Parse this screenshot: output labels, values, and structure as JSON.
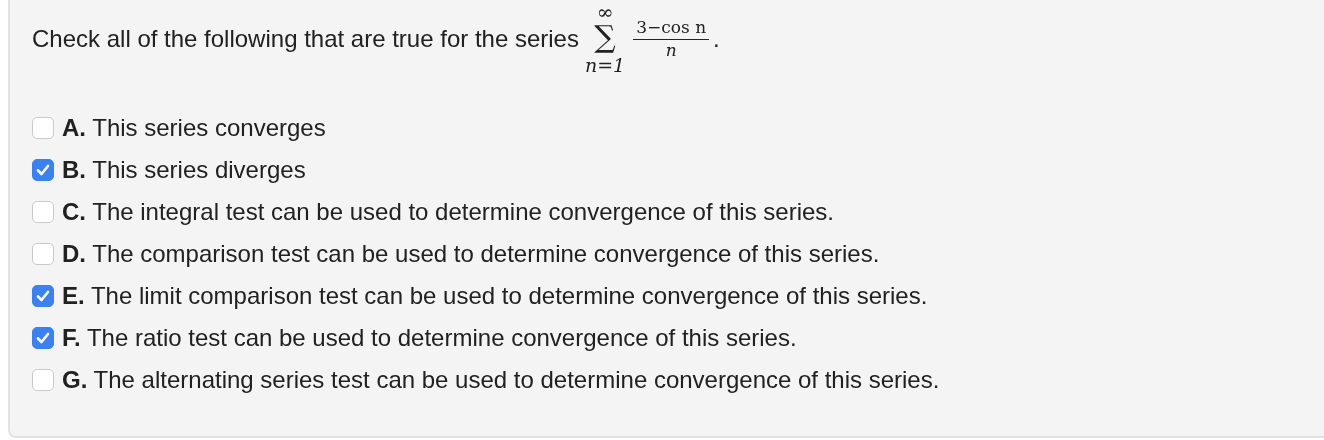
{
  "question": {
    "text": "Check all of the following that are true for the series",
    "math": {
      "upper": "∞",
      "operator": "∑",
      "lower": "n=1",
      "numerator": "3−cos n",
      "denominator": "n",
      "end": "."
    }
  },
  "options": [
    {
      "label": "**A.** This series converges",
      "checked": false
    },
    {
      "label": "**B.** This series diverges",
      "checked": true
    },
    {
      "label": "**C.** The integral test can be used to determine convergence of this series.",
      "checked": false
    },
    {
      "label": "**D.** The comparison test can be used to determine convergence of this series.",
      "checked": false
    },
    {
      "label": "**E.** The limit comparison test can be used to determine convergence of this series.",
      "checked": true
    },
    {
      "label": "**F.** The ratio test can be used to determine convergence of this series.",
      "checked": true
    },
    {
      "label": "**G.** The alternating series test can be used to determine convergence of this series.",
      "checked": false
    }
  ]
}
